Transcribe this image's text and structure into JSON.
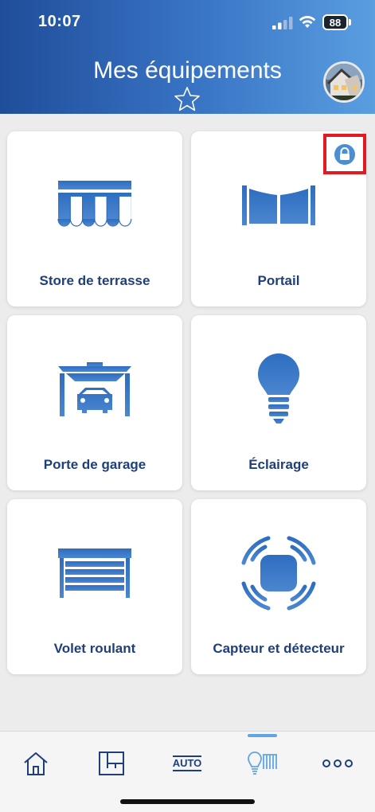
{
  "status_bar": {
    "time": "10:07",
    "battery": "88"
  },
  "header": {
    "title": "Mes équipements"
  },
  "cards": [
    {
      "label": "Store de terrasse",
      "icon": "awning-icon"
    },
    {
      "label": "Portail",
      "icon": "gate-icon",
      "badge": "lock-icon"
    },
    {
      "label": "Porte de garage",
      "icon": "garage-door-icon"
    },
    {
      "label": "Éclairage",
      "icon": "light-bulb-icon"
    },
    {
      "label": "Volet roulant",
      "icon": "roller-shutter-icon"
    },
    {
      "label": "Capteur et détecteur",
      "icon": "sensor-icon"
    }
  ],
  "tab_bar": {
    "items": [
      {
        "icon": "home-icon"
      },
      {
        "icon": "floor-plan-icon"
      },
      {
        "label": "AUTO",
        "icon": "auto-icon"
      },
      {
        "icon": "equipment-icon",
        "active": true
      },
      {
        "icon": "more-icon"
      }
    ]
  },
  "colors": {
    "primary": "#1e3f7c",
    "accent": "#5fa6e3",
    "icon_blue": "#2f6bbf",
    "highlight_red": "#e21b23"
  }
}
